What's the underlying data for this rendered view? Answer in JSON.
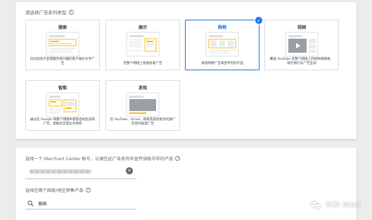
{
  "campaign_type": {
    "section_title": "请选择广告系列类型",
    "cards": [
      {
        "title": "搜索",
        "desc": "向对您的产品或服务感兴趣的客户展示文字广告",
        "selected": false
      },
      {
        "title": "展示",
        "desc": "在整个网络上投放各类广告",
        "selected": false
      },
      {
        "title": "购物",
        "desc": "投放购物广告来宣传您的产品",
        "selected": true
      },
      {
        "title": "视频",
        "desc": "覆盖 YouTube 及整个网络上的视频观看者，吸引他们与广告互动",
        "selected": false
      },
      {
        "title": "智能",
        "desc": "通过在 Google 和整个网络中投放自动生成的广告，帮助您实现业务目标",
        "selected": false
      },
      {
        "title": "发现",
        "desc": "在 YouTube、Gmail、探索及其他更多优质广告空间投放广告",
        "selected": false
      }
    ]
  },
  "merchant": {
    "account_label": "选择一个 Merchant Center 帐号，以便在此广告系列中宣传该帐号中的产品",
    "country_label": "选择在哪个国家/地区销售产品",
    "country_value": "美国"
  },
  "watermark": {
    "text": "ROI MAN"
  },
  "colors": {
    "accent": "#1a73e8",
    "video_thumb": "#9aa0a6",
    "highlight_yellow": "#fbbc04"
  },
  "icons": {
    "help": "help-circle-icon",
    "check": "checkmark-icon",
    "clear": "clear-x-icon",
    "search": "search-icon",
    "wechat": "wechat-icon"
  }
}
